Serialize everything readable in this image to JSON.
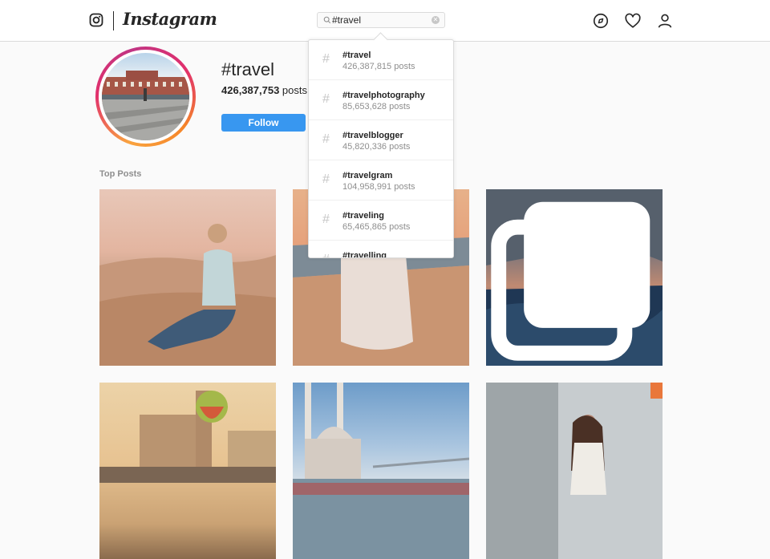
{
  "nav": {
    "brand": "Instagram",
    "search_value": "#travel",
    "icons": [
      "instagram-glyph-icon",
      "search-icon",
      "clear-icon",
      "compass-icon",
      "heart-icon",
      "profile-icon"
    ]
  },
  "hashtag": {
    "title": "#travel",
    "post_count": "426,387,753",
    "post_label": "posts",
    "follow_label": "Follow"
  },
  "section": {
    "top_posts_label": "Top Posts"
  },
  "search_results": [
    {
      "name": "#travel",
      "count": "426,387,815 posts"
    },
    {
      "name": "#travelphotography",
      "count": "85,653,628 posts"
    },
    {
      "name": "#travelblogger",
      "count": "45,820,336 posts"
    },
    {
      "name": "#travelgram",
      "count": "104,958,991 posts"
    },
    {
      "name": "#traveling",
      "count": "65,465,865 posts"
    },
    {
      "name": "#travelling",
      "count": ""
    }
  ],
  "colors": {
    "accent": "#3897f0",
    "border": "#dbdbdb",
    "text_primary": "#262626",
    "text_secondary": "#8e8e8e",
    "background": "#fafafa"
  }
}
